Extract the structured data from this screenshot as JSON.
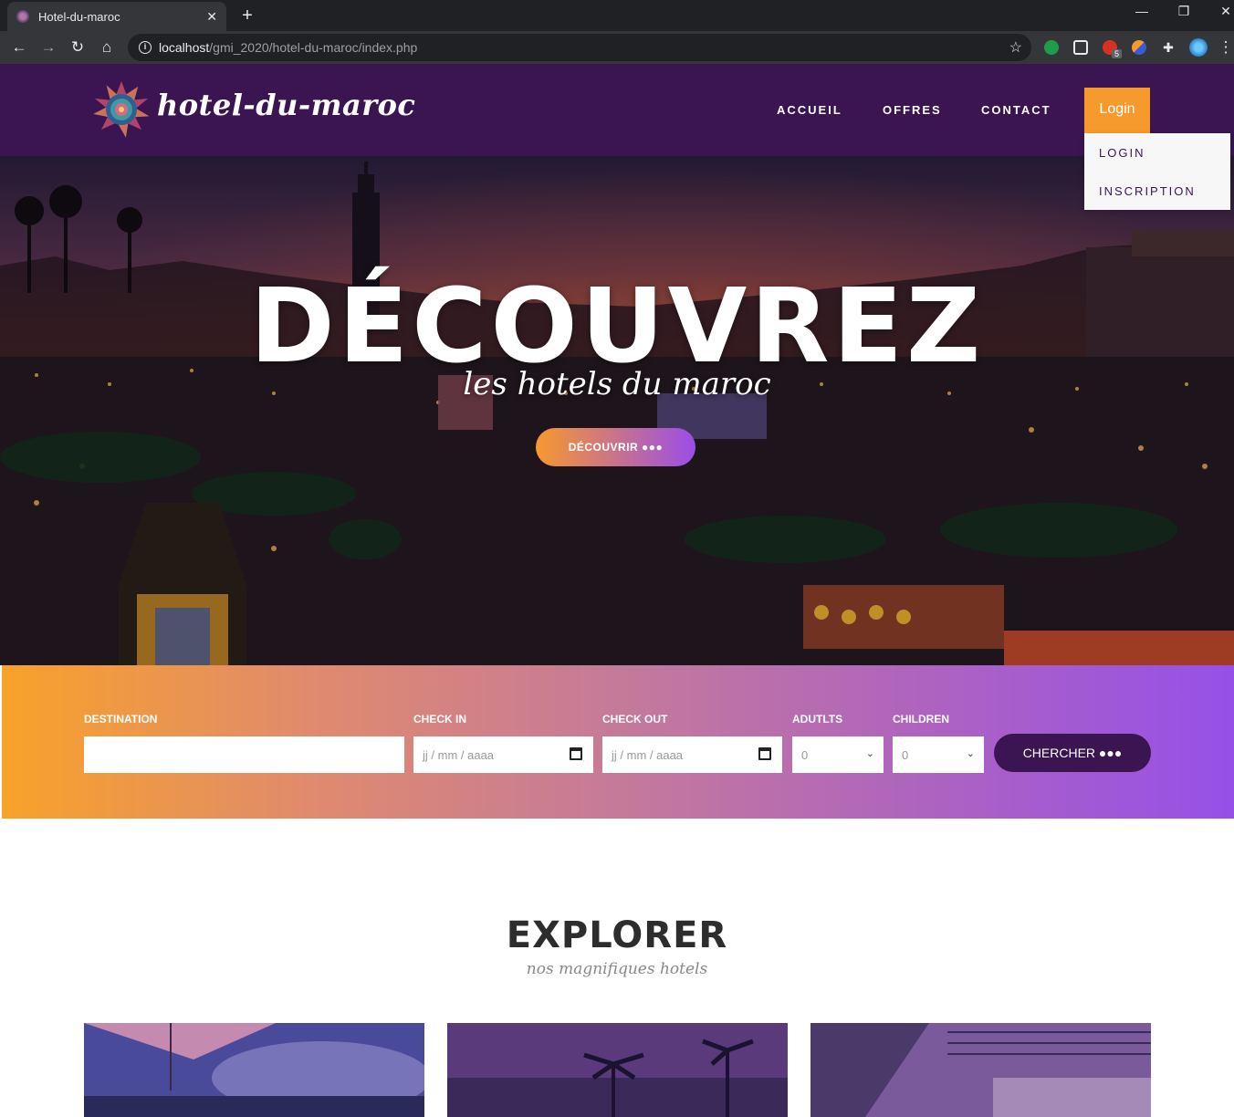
{
  "browser": {
    "tab_title": "Hotel-du-maroc",
    "url_host": "localhost",
    "url_path": "/gmi_2020/hotel-du-maroc/index.php",
    "extension_badge": "5"
  },
  "header": {
    "brand": "hotel-du-maroc",
    "nav": [
      "ACCUEIL",
      "OFFRES",
      "CONTACT"
    ],
    "login_label": "Login",
    "dropdown": [
      "LOGIN",
      "INSCRIPTION"
    ]
  },
  "hero": {
    "title": "DÉCOUVREZ",
    "subtitle": "les hotels du maroc",
    "button": "DÉCOUVRIR ●●●"
  },
  "search": {
    "destination_label": "DESTINATION",
    "destination_value": "",
    "checkin_label": "CHECK IN",
    "checkin_placeholder": "jj / mm / aaaa",
    "checkout_label": "CHECK OUT",
    "checkout_placeholder": "jj / mm / aaaa",
    "adults_label": "ADUTLTS",
    "adults_value": "0",
    "children_label": "CHILDREN",
    "children_value": "0",
    "button": "CHERCHER ●●●"
  },
  "explore": {
    "title": "EXPLORER",
    "subtitle": "nos magnifiques hotels"
  },
  "colors": {
    "brand_purple": "#3a1552",
    "accent_orange": "#f79a2e",
    "gradient_end": "#9650e8"
  }
}
